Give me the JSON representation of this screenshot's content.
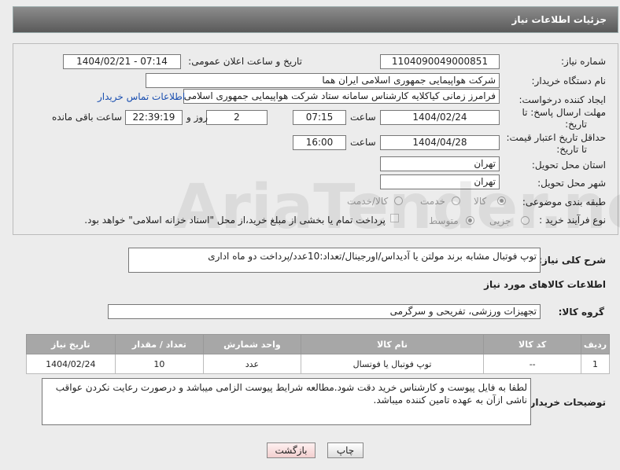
{
  "header": {
    "title": "جزئیات اطلاعات نیاز"
  },
  "form": {
    "need_number_label": "شماره نیاز:",
    "need_number": "1104090049000851",
    "announce_label": "تاریخ و ساعت اعلان عمومی:",
    "announce_value": "1404/02/21 - 07:14",
    "buyer_org_label": "نام دستگاه خریدار:",
    "buyer_org": "شرکت هواپیمایی جمهوری اسلامی ایران هما",
    "creator_label": "ایجاد کننده درخواست:",
    "creator": "فرامرز زمانی کیاکلایه کارشناس سامانه ستاد شرکت هواپیمایی جمهوری اسلامی ایران هما",
    "contact_link": "اطلاعات تماس خریدار",
    "deadline_label_1": "مهلت ارسال پاسخ: تا",
    "deadline_label_2": "تاریخ:",
    "deadline_date": "1404/02/24",
    "time_label": "ساعت",
    "deadline_time": "07:15",
    "days": "2",
    "days_label": "روز و",
    "remaining_time": "22:39:19",
    "remaining_label": "ساعت باقی مانده",
    "validity_label_1": "حداقل تاریخ اعتبار قیمت:",
    "validity_label_2": "تا تاریخ:",
    "validity_date": "1404/04/28",
    "validity_time": "16:00",
    "province_label": "استان محل تحویل:",
    "province": "تهران",
    "city_label": "شهر محل تحویل:",
    "city": "تهران",
    "category_label": "طبقه بندی موضوعی:",
    "category_options": [
      "کالا",
      "خدمت",
      "کالا/خدمت"
    ],
    "process_label": "نوع فرآیند خرید :",
    "process_options": [
      "جزیی",
      "متوسط"
    ],
    "payment_note": "پرداخت تمام یا بخشی از مبلغ خرید،از محل \"اسناد خزانه اسلامی\" خواهد بود."
  },
  "description": {
    "label": "شرح کلی نیاز:",
    "text": "توپ فوتبال مشابه برند مولتن یا آدیداس/اورجینال/تعداد:10عدد/پرداخت دو ماه اداری"
  },
  "goods": {
    "section_title": "اطلاعات کالاهای مورد نیاز",
    "group_label": "گروه کالا:",
    "group_value": "تجهیزات ورزشی، تفریحی و سرگرمی",
    "columns": [
      "ردیف",
      "کد کالا",
      "نام کالا",
      "واحد شمارش",
      "تعداد / مقدار",
      "تاریخ نیاز"
    ],
    "rows": [
      [
        "1",
        "--",
        "توپ فوتبال یا فوتسال",
        "عدد",
        "10",
        "1404/02/24"
      ]
    ]
  },
  "buyer_notes": {
    "label": "توضیحات خریدار:",
    "text": "لطفا به فایل پیوست و کارشناس خرید دقت شود.مطالعه شرایط پیوست الزامی میباشد و درصورت رعایت نکردن عواقب ناشی ازآن به عهده تامین کننده میباشد."
  },
  "buttons": {
    "print": "چاپ",
    "back": "بازگشت"
  },
  "watermark": {
    "text": "AriaTender.neT"
  },
  "colors": {
    "title_bg": "#6e6e6e",
    "table_header": "#a7a7a7",
    "link": "#1a4fb0",
    "back_button": "#f9dede"
  }
}
